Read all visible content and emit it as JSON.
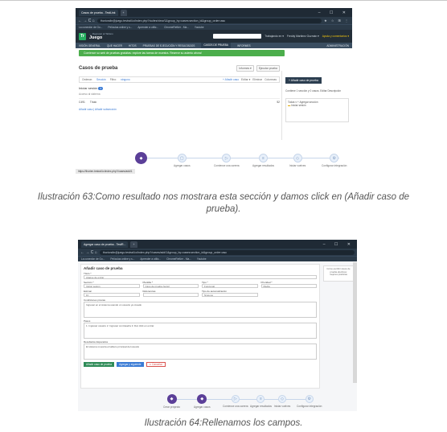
{
  "figure1": {
    "browser": {
      "tabs": [
        "Casos de prueba - TestLink",
        "+"
      ],
      "url": "thoriondin@juego.testrail.io/index.php?/suites/view/1&group_by=cases:section_id&group_order=asc",
      "bookmarks": [
        "La conexión de Go...",
        "Películas online y s...",
        "Aprender a utiliz...",
        "ChromeRefüer - Ma...",
        "Youtube"
      ],
      "window_controls": "– ☐ ✕",
      "nav_glyphs": "← → C ⌂",
      "toolbar_icons": "★ ☆ ⊞ ⋮"
    },
    "app": {
      "project_small": "— Regresar al Tablero",
      "project_name": "Juego",
      "logo": "Tr",
      "header_links": [
        "Trabajando en ▾",
        "Freddy Martinez Guzmán ▾",
        "Ayuda y comentarios ▾"
      ],
      "nav": [
        "VISIÓN GENERAL",
        "QUE HACER",
        "HITOS",
        "PRUEBAS DE EJECUCIÓN Y RESULTADOS",
        "CASOS DE PRUEBA",
        "INFORMES"
      ],
      "nav_right": "ADMINISTRACIÓN",
      "banner": "Comience su web de pruebas gratuitas: explore las tareas de muestra. Reserve su asiento ahora!",
      "page_title": "Casos de prueba",
      "actions": [
        "Informes ▾",
        "Ejecutar prueba"
      ],
      "filter": {
        "order": "Ordenar:",
        "order_value": "Sección",
        "filter": "Filtro:",
        "filter_value": "ninguno"
      },
      "filter_right": [
        "+ Añadir caso",
        "Editar ▾",
        "Eliminar",
        "Columnas"
      ],
      "section": "Iniciar sesión",
      "section_badge": "0",
      "section_desc": "Acceso al sistema",
      "row": {
        "id": "C491",
        "title": "Título",
        "count": "52"
      },
      "links": "Añadir caso | Añadir subsección",
      "side_button": "+ Añadir caso de prueba",
      "side_text": "Contiene 1 sección y 0 casos. Editar Descripción",
      "side_tree_header": "Todas ▾  + Agregar sección",
      "side_tree_item": "Iniciar sesión"
    },
    "workflow": {
      "steps": [
        "Agregar casos",
        "Comience una carrera",
        "Agregar resultados",
        "Iniciar vuelves",
        "Configurar integración"
      ],
      "active_glyph": "◆",
      "glyphs": [
        "▢",
        "▷",
        "≡",
        "◇",
        "⚙"
      ]
    },
    "status_url": "https://thorien.testrail.io/index.php?/cases/add/1"
  },
  "caption1": "Ilustración 63:Como resultado nos mostrara esta sección y damos click en (Añadir caso de prueba).",
  "figure2": {
    "browser": {
      "tabs": [
        "Agregar caso de prueba - TestR...",
        "+"
      ],
      "url": "thoriondin@juego.testrail.io/index.php?/cases/add/1&group_by=cases:section_id&group_order=asc",
      "bookmarks": [
        "La conexión de Go...",
        "Películas online y s...",
        "Aprender a utiliz...",
        "ChromeRefüer - Ma...",
        "Youtube"
      ],
      "window_controls": "– ☐ ✕",
      "nav_glyphs": "← → C ⌂"
    },
    "form": {
      "title": "Añadir caso de prueba",
      "title_label": "Título *",
      "title_value": "Ataque de entrar",
      "row1_labels": [
        "Sección *",
        "Plantilla *",
        "Tipo *",
        "Prioridad *"
      ],
      "row1_values": [
        "Iniciar sesión",
        "Caso de prueba (texto)",
        "Funcional",
        "Media"
      ],
      "row2_labels": [
        "Estimar",
        "Referencias",
        "Tipo de automatización"
      ],
      "row2_values": [
        "1h",
        "",
        "Ninguno"
      ],
      "preconditions_label": "Condiciones previas",
      "preconditions_value": "Ingresar en el sistema usando un usuario ya creado",
      "steps_label": "Pasos",
      "steps_value": "1. Ingresar usuario 2. Ingresar contraseña 3. Dar click en entrar",
      "expected_label": "Resultados Esperados",
      "expected_value": "El sistema muestra el tablero principal del usuario",
      "buttons": [
        "Añadir caso de prueba",
        "Agregar y siguiente",
        "✕ Cancelar"
      ],
      "side_note": "Cómo escribir casos de prueba efectivos: mejores prácticas"
    },
    "workflow": {
      "steps": [
        "Crear proyecto",
        "Agregar casos",
        "Comience una carrera",
        "Agregar resultados",
        "Iniciar vuelves",
        "Configurar integración"
      ]
    }
  },
  "caption2": "Ilustración 64:Rellenamos los campos."
}
